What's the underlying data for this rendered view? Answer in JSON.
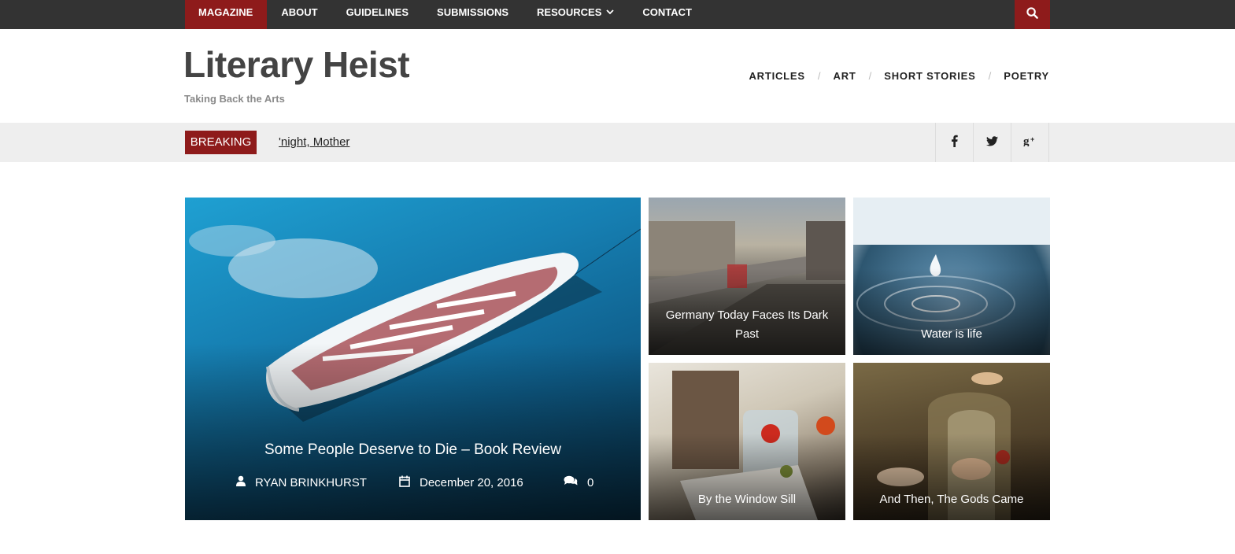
{
  "topnav": {
    "items": [
      "MAGAZINE",
      "ABOUT",
      "GUIDELINES",
      "SUBMISSIONS",
      "RESOURCES",
      "CONTACT"
    ],
    "active": "MAGAZINE"
  },
  "site": {
    "title": "Literary Heist",
    "tagline": "Taking Back the Arts"
  },
  "catnav": {
    "items": [
      "ARTICLES",
      "ART",
      "SHORT STORIES",
      "POETRY"
    ],
    "separator": "/"
  },
  "breaking": {
    "label": "BREAKING",
    "headline": "'night, Mother"
  },
  "social": {
    "icons": [
      "facebook-icon",
      "twitter-icon",
      "google-plus-icon"
    ]
  },
  "featured": {
    "title": "Some People Deserve to Die – Book Review",
    "author": "RYAN BRINKHURST",
    "date": "December 20, 2016",
    "comments": "0"
  },
  "cards": [
    {
      "title": "Germany Today Faces Its Dark Past"
    },
    {
      "title": "Water is life"
    },
    {
      "title": "By the Window Sill"
    },
    {
      "title": "And Then, The Gods Came"
    }
  ],
  "colors": {
    "topbar": "#333333",
    "accent": "#8e1b1b",
    "breakbar": "#eeeeee",
    "title": "#444444"
  }
}
